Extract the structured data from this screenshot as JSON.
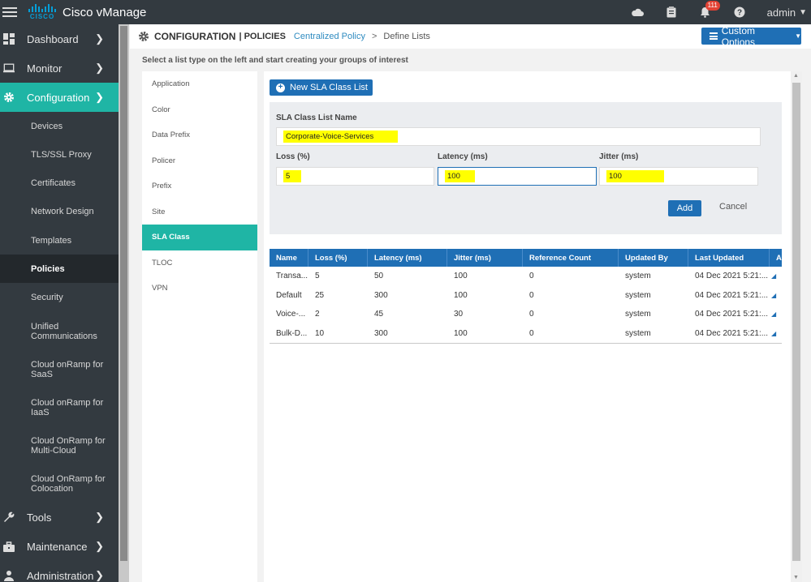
{
  "app": {
    "title": "Cisco vManage",
    "logo_text": "CISCO"
  },
  "topbar": {
    "notifications_count": "111",
    "user": "admin"
  },
  "sidebar": {
    "main_items": [
      {
        "label": "Dashboard",
        "icon": "dashboard-icon"
      },
      {
        "label": "Monitor",
        "icon": "monitor-icon"
      },
      {
        "label": "Configuration",
        "icon": "gear-icon"
      }
    ],
    "sub_items": [
      "Devices",
      "TLS/SSL Proxy",
      "Certificates",
      "Network Design",
      "Templates",
      "Policies",
      "Security",
      "Unified Communications",
      "Cloud onRamp for SaaS",
      "Cloud onRamp for IaaS",
      "Cloud OnRamp for Multi-Cloud",
      "Cloud OnRamp for Colocation"
    ],
    "bottom_items": [
      {
        "label": "Tools",
        "icon": "wrench-icon"
      },
      {
        "label": "Maintenance",
        "icon": "toolbox-icon"
      },
      {
        "label": "Administration",
        "icon": "admin-icon"
      }
    ]
  },
  "header": {
    "section": "CONFIGURATION",
    "subsection": "| POLICIES",
    "breadcrumb_link": "Centralized Policy",
    "breadcrumb_sep": ">",
    "breadcrumb_current": "Define Lists",
    "custom_options": "Custom Options"
  },
  "instructions": "Select a list type on the left and start creating your groups of interest",
  "list_types": [
    "Application",
    "Color",
    "Data Prefix",
    "Policer",
    "Prefix",
    "Site",
    "SLA Class",
    "TLOC",
    "VPN"
  ],
  "form": {
    "new_button": "New SLA Class List",
    "name_label": "SLA Class List Name",
    "name_value": "Corporate-Voice-Services",
    "loss_label": "Loss (%)",
    "loss_value": "5",
    "latency_label": "Latency (ms)",
    "latency_value": "100",
    "jitter_label": "Jitter (ms)",
    "jitter_value": "100",
    "add_label": "Add",
    "cancel_label": "Cancel"
  },
  "table": {
    "columns": [
      "Name",
      "Loss (%)",
      "Latency (ms)",
      "Jitter (ms)",
      "Reference Count",
      "Updated By",
      "Last Updated",
      "A"
    ],
    "rows": [
      [
        "Transa...",
        "5",
        "50",
        "100",
        "0",
        "system",
        "04 Dec 2021 5:21:..."
      ],
      [
        "Default",
        "25",
        "300",
        "100",
        "0",
        "system",
        "04 Dec 2021 5:21:..."
      ],
      [
        "Voice-...",
        "2",
        "45",
        "30",
        "0",
        "system",
        "04 Dec 2021 5:21:..."
      ],
      [
        "Bulk-D...",
        "10",
        "300",
        "100",
        "0",
        "system",
        "04 Dec 2021 5:21:..."
      ]
    ]
  },
  "colors": {
    "accent_teal": "#1fb5a5",
    "primary_blue": "#1f6fb5",
    "highlight": "#ffff00",
    "nav_bg": "#333a40"
  }
}
